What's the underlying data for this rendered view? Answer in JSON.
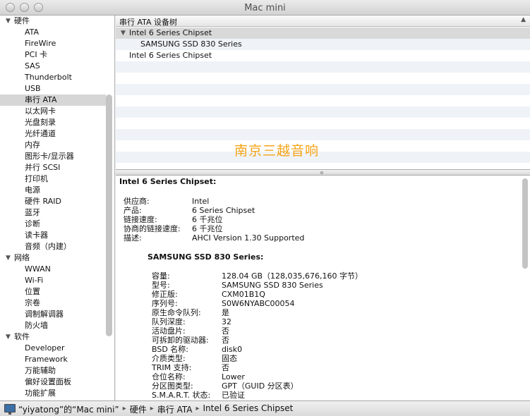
{
  "window": {
    "title": "Mac mini"
  },
  "sidebar": {
    "items": [
      {
        "label": "硬件",
        "level": 0,
        "expanded": true
      },
      {
        "label": "ATA",
        "level": 1
      },
      {
        "label": "FireWire",
        "level": 1
      },
      {
        "label": "PCI 卡",
        "level": 1
      },
      {
        "label": "SAS",
        "level": 1
      },
      {
        "label": "Thunderbolt",
        "level": 1
      },
      {
        "label": "USB",
        "level": 1
      },
      {
        "label": "串行 ATA",
        "level": 1,
        "selected": true
      },
      {
        "label": "以太网卡",
        "level": 1
      },
      {
        "label": "光盘刻录",
        "level": 1
      },
      {
        "label": "光纤通道",
        "level": 1
      },
      {
        "label": "内存",
        "level": 1
      },
      {
        "label": "图形卡/显示器",
        "level": 1
      },
      {
        "label": "并行 SCSI",
        "level": 1
      },
      {
        "label": "打印机",
        "level": 1
      },
      {
        "label": "电源",
        "level": 1
      },
      {
        "label": "硬件 RAID",
        "level": 1
      },
      {
        "label": "蓝牙",
        "level": 1
      },
      {
        "label": "诊断",
        "level": 1
      },
      {
        "label": "读卡器",
        "level": 1
      },
      {
        "label": "音频（内建）",
        "level": 1
      },
      {
        "label": "网络",
        "level": 0,
        "expanded": true
      },
      {
        "label": "WWAN",
        "level": 1
      },
      {
        "label": "Wi-Fi",
        "level": 1
      },
      {
        "label": "位置",
        "level": 1
      },
      {
        "label": "宗卷",
        "level": 1
      },
      {
        "label": "调制解调器",
        "level": 1
      },
      {
        "label": "防火墙",
        "level": 1
      },
      {
        "label": "软件",
        "level": 0,
        "expanded": true
      },
      {
        "label": "Developer",
        "level": 1
      },
      {
        "label": "Framework",
        "level": 1
      },
      {
        "label": "万能辅助",
        "level": 1
      },
      {
        "label": "偏好设置面板",
        "level": 1
      },
      {
        "label": "功能扩展",
        "level": 1
      }
    ]
  },
  "tree": {
    "header": "串行 ATA 设备树",
    "rows": [
      {
        "label": "Intel 6 Series Chipset",
        "level": 0,
        "expanded": true,
        "selected": true
      },
      {
        "label": "SAMSUNG SSD 830 Series",
        "level": 1
      },
      {
        "label": "Intel 6 Series Chipset",
        "level": 0
      }
    ],
    "watermark": "南京三越音响"
  },
  "detail": {
    "title": "Intel 6 Series Chipset:",
    "controller": [
      {
        "key": "供应商:",
        "value": "Intel"
      },
      {
        "key": "产品:",
        "value": "6 Series Chipset"
      },
      {
        "key": "链接速度:",
        "value": "6 千兆位"
      },
      {
        "key": "协商的链接速度:",
        "value": "6 千兆位"
      },
      {
        "key": "描述:",
        "value": "AHCI Version 1.30 Supported"
      }
    ],
    "device_title": "SAMSUNG SSD 830 Series:",
    "device": [
      {
        "key": "容量:",
        "value": "128.04 GB（128,035,676,160 字节）"
      },
      {
        "key": "型号:",
        "value": "SAMSUNG SSD 830 Series"
      },
      {
        "key": "修正版:",
        "value": "CXM01B1Q"
      },
      {
        "key": "序列号:",
        "value": "S0W6NYABC00054"
      },
      {
        "key": "原生命令队列:",
        "value": "是"
      },
      {
        "key": "队列深度:",
        "value": "32"
      },
      {
        "key": "活动盘片:",
        "value": "否"
      },
      {
        "key": "可拆卸的驱动器:",
        "value": "否"
      },
      {
        "key": "BSD 名称:",
        "value": "disk0"
      },
      {
        "key": "介质类型:",
        "value": "固态"
      },
      {
        "key": "TRIM 支持:",
        "value": "否"
      },
      {
        "key": "仓位名称:",
        "value": "Lower"
      },
      {
        "key": "分区图类型:",
        "value": "GPT（GUID 分区表）"
      },
      {
        "key": "S.M.A.R.T. 状态:",
        "value": "已验证"
      }
    ]
  },
  "pathbar": {
    "crumbs": [
      "“yiyatong”的“Mac mini”",
      "硬件",
      "串行 ATA",
      "Intel 6 Series Chipset"
    ],
    "separator": "▸"
  },
  "icons": {
    "computer": "computer-icon",
    "disclosure": "disclosure-triangle-icon"
  },
  "colors": {
    "watermark": "#f5a316",
    "selection": "#d6d6d6",
    "alt_row": "#eff3f8"
  }
}
